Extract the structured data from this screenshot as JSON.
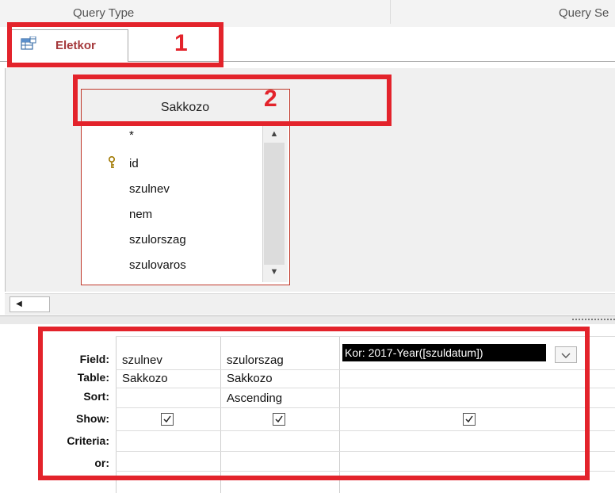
{
  "ribbon": {
    "groups": [
      "Query Type",
      "Query Se"
    ]
  },
  "object_tab": {
    "label": "Eletkor",
    "icon": "query-datasheet-icon"
  },
  "table": {
    "title": "Sakkozo",
    "fields": [
      "*",
      "id",
      "szulnev",
      "nem",
      "szulorszag",
      "szulovaros"
    ],
    "primary_key_field": "id"
  },
  "grid": {
    "row_labels": [
      "Field:",
      "Table:",
      "Sort:",
      "Show:",
      "Criteria:",
      "or:"
    ],
    "columns": [
      {
        "field": "szulnev",
        "table": "Sakkozo",
        "sort": "",
        "show": true,
        "criteria": "",
        "or": ""
      },
      {
        "field": "szulorszag",
        "table": "Sakkozo",
        "sort": "Ascending",
        "show": true,
        "criteria": "",
        "or": ""
      },
      {
        "field": "Kor: 2017-Year([szuldatum])",
        "table": "",
        "sort": "",
        "show": true,
        "criteria": "",
        "or": ""
      }
    ]
  },
  "annotations": [
    "1",
    "2"
  ],
  "colors": {
    "annotation": "#e3232b",
    "tab_text": "#a4373a",
    "selection_bg": "#000000"
  }
}
